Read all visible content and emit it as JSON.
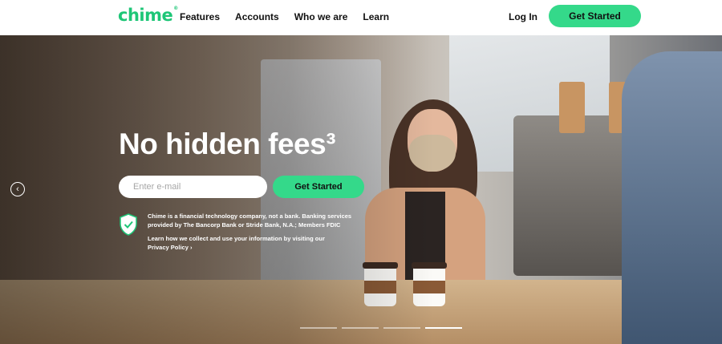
{
  "nav": {
    "logo": "chime",
    "logo_mark": "®",
    "links": [
      "Features",
      "Accounts",
      "Who we are",
      "Learn"
    ],
    "login": "Log In",
    "cta": "Get Started"
  },
  "hero": {
    "headline": "No hidden fees³",
    "email_placeholder": "Enter e-mail",
    "cta": "Get Started",
    "disclaimer_line1": "Chime is a financial technology company, not a bank. Banking services provided by The Bancorp Bank or Stride Bank, N.A.; Members FDIC",
    "disclaimer_line2": "Learn how we collect and use your information by visiting our",
    "privacy_link": "Privacy Policy ›",
    "prev_icon": "chevron-left-icon",
    "shield_icon": "shield-check-icon",
    "slides": 4,
    "active_slide": 4
  },
  "colors": {
    "brand": "#1ec677",
    "cta": "#34d98a"
  }
}
